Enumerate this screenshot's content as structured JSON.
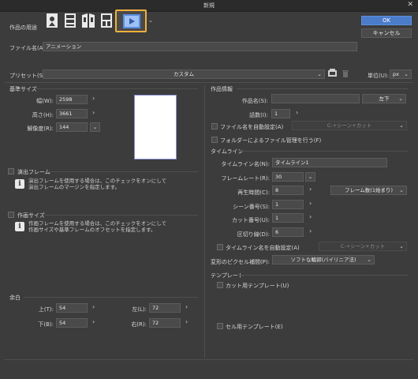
{
  "window": {
    "title": "新規",
    "close_glyph": "✕"
  },
  "usage": {
    "label": "作品の用途",
    "icons": [
      "illustration-icon",
      "webtoon-icon",
      "comic-icon",
      "print-icon",
      "animation-icon"
    ],
    "selected": "animation-icon",
    "highlight_color": "#f0b03a"
  },
  "buttons": {
    "ok": "OK",
    "cancel": "キャンセル"
  },
  "filename": {
    "label": "ファイル名(A):",
    "value": "アニメーション"
  },
  "preset": {
    "label": "プリセット(S):",
    "value": "カスタム",
    "unit_label": "単位(U):",
    "unit_value": "px"
  },
  "base_size": {
    "section": "基準サイズ",
    "width_label": "幅(W):",
    "width_value": "2598",
    "height_label": "高さ(H):",
    "height_value": "3661",
    "resolution_label": "解像度(R):",
    "resolution_value": "144"
  },
  "frame": {
    "label": "演出フレーム",
    "desc1": "演出フレームを使用する場合は、このチェックをオンにして",
    "desc2": "演出フレームのマージンを指定します。"
  },
  "work_size": {
    "label": "作画サイズ",
    "desc1": "作画フレームを使用する場合は、このチェックをオンにして",
    "desc2": "作画サイズや基準フレームのオフセットを指定します。"
  },
  "margin": {
    "section": "余白",
    "top_label": "上(T):",
    "top_value": "54",
    "bottom_label": "下(B):",
    "bottom_value": "54",
    "left_label": "左(L):",
    "left_value": "72",
    "right_label": "右(R):",
    "right_value": "72"
  },
  "work_info": {
    "section": "作品情報",
    "title_label": "作品名(S):",
    "title_value": "",
    "title_pos": "左下",
    "episode_label": "話数(I):",
    "episode_value": "1",
    "autoname_label": "ファイル名を自動設定(A)",
    "autoname_value": "C-+シーン+カット",
    "folder_label": "フォルダーによるファイル管理を行う(F)"
  },
  "timeline": {
    "section": "タイムライン",
    "name_label": "タイムライン名(N):",
    "name_value": "タイムライン1",
    "fps_label": "フレームレート(R):",
    "fps_value": "30",
    "duration_label": "再生時間(C):",
    "duration_value": "8",
    "duration_unit": "フレーム数(1始まり)",
    "scene_label": "シーン番号(S):",
    "scene_value": "1",
    "cut_label": "カット番号(U):",
    "cut_value": "1",
    "cutmark_label": "区切り線(D):",
    "cutmark_value": "6",
    "autoname_label": "タイムライン名を自動設定(A)",
    "autoname_value": "C-+シーン+カット",
    "interp_label": "変形のピクセル補間(P):",
    "interp_value": "ソフトな輪郭(バイリニア法)"
  },
  "template": {
    "section": "テンプレート",
    "cut_label": "カット用テンプレート(U)",
    "cel_label": "セル用テンプレート(E)"
  }
}
